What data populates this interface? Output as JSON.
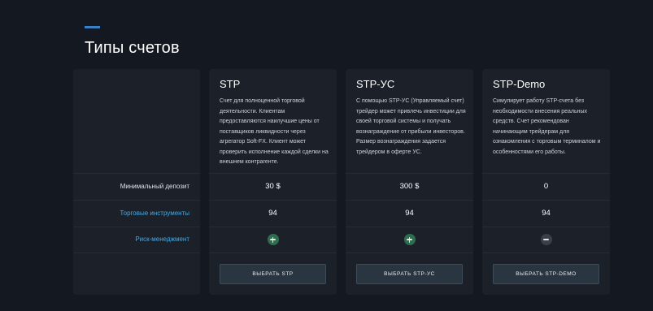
{
  "page": {
    "title": "Типы счетов"
  },
  "rows": {
    "min_deposit": "Минимальный депозит",
    "instruments": "Торговые инструменты",
    "risk": "Риск-менеджмент"
  },
  "plans": [
    {
      "name": "STP",
      "description": "Счет для полноценной торговой деятельности. Клиентам предоставляются наилучшие цены от поставщиков ликвидности через агрегатор Soft-FX. Клиент может проверить исполнение каждой сделки на внешнем контрагенте.",
      "min_deposit": "30 $",
      "instruments": "94",
      "risk_icon": "plus-circle-icon",
      "button": "ВЫБРАТЬ STP"
    },
    {
      "name": "STP-УС",
      "description": "С помощью STP-УС (Управляемый счет) трейдер может привлечь инвестиции для своей торговой системы и получать вознаграждение от прибыли инвесторов. Размер вознаграждения задается трейдером в оферте УС.",
      "min_deposit": "300 $",
      "instruments": "94",
      "risk_icon": "plus-circle-icon",
      "button": "ВЫБРАТЬ STP-УС"
    },
    {
      "name": "STP-Demo",
      "description": "Симулирует работу STP-счета без необходимости внесения реальных средств. Счет рекомендован начинающим трейдерам для ознакомления с торговым терминалом и особенностями его работы.",
      "min_deposit": "0",
      "instruments": "94",
      "risk_icon": "minus-circle-icon",
      "button": "ВЫБРАТЬ STP-DEMO"
    }
  ],
  "colors": {
    "background": "#141820",
    "card": "#1b2029",
    "accent": "#3d7fc4",
    "link": "#4aa8e0",
    "plus": "#2f6d4f",
    "minus": "#3a4049"
  }
}
